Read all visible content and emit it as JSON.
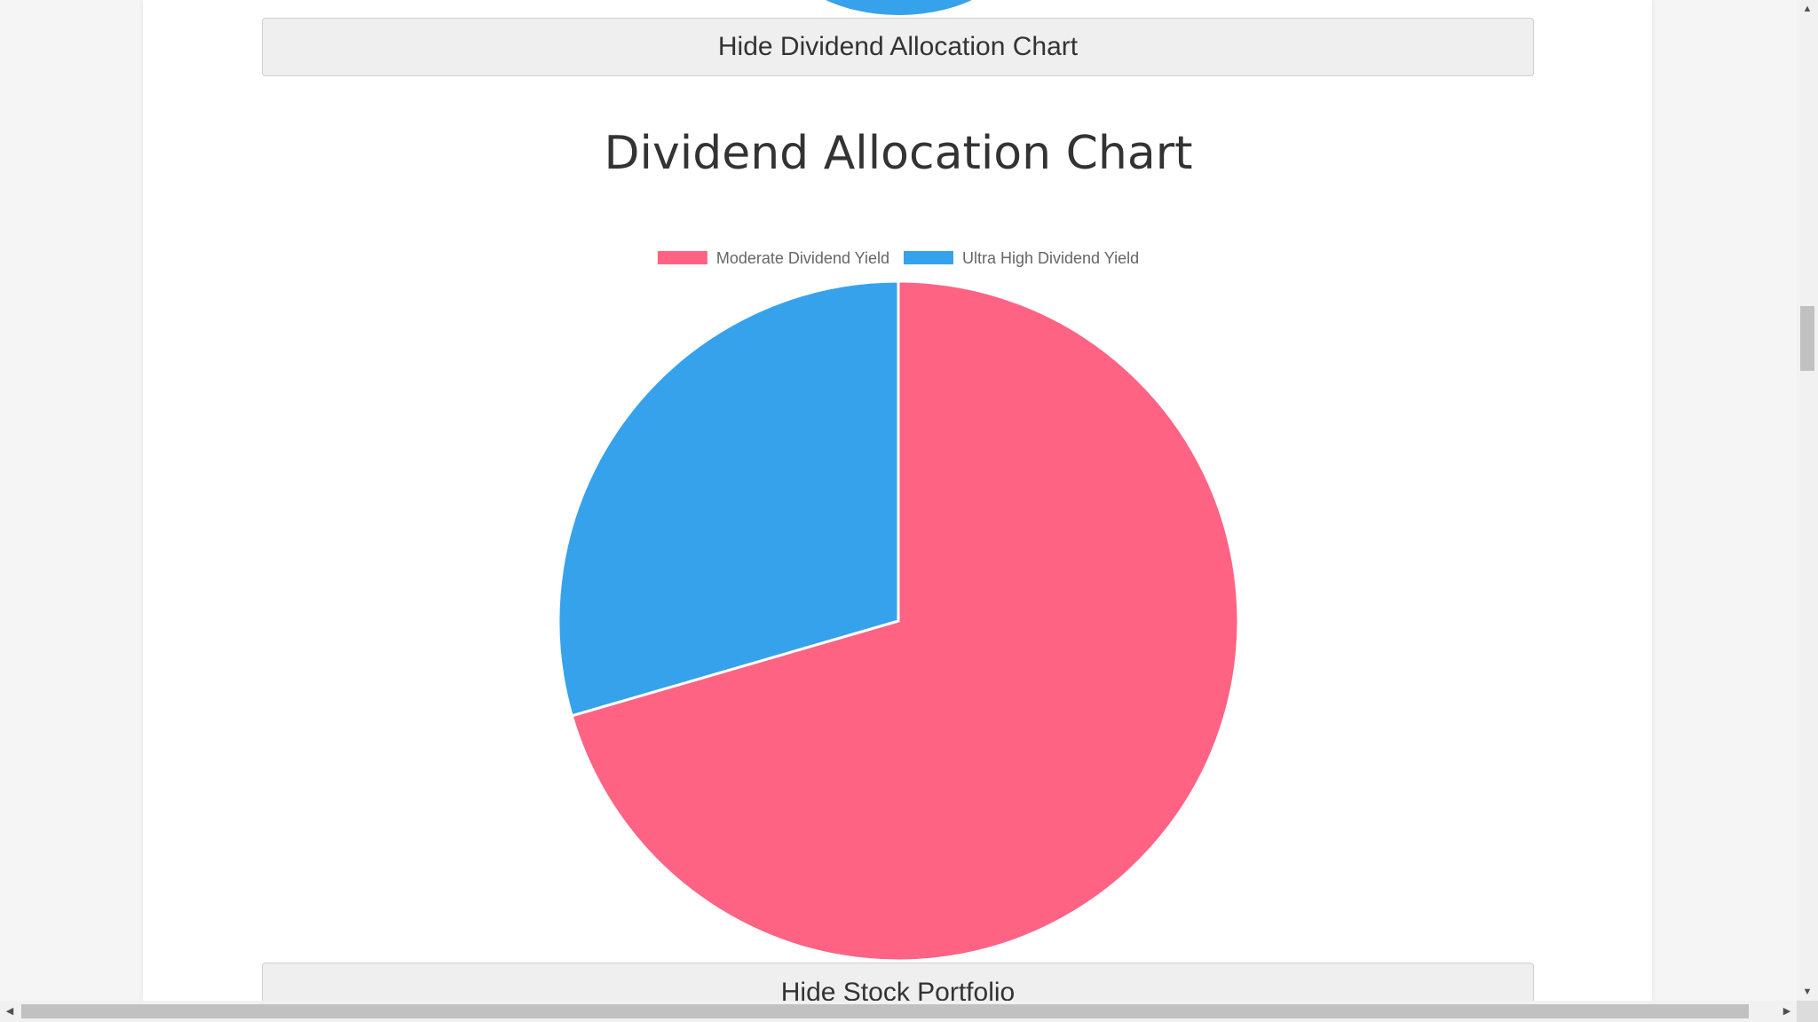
{
  "buttons": {
    "hide_dividend_chart": "Hide Dividend Allocation Chart",
    "hide_stock_portfolio": "Hide Stock Portfolio"
  },
  "chart_data": {
    "type": "pie",
    "title": "Dividend Allocation Chart",
    "categories": [
      "Moderate Dividend Yield",
      "Ultra High Dividend Yield"
    ],
    "values": [
      70.5,
      29.5
    ],
    "colors": [
      "#ff6384",
      "#36a2eb"
    ],
    "legend_position": "top"
  },
  "scrollbars": {
    "up_icon": "triangle-up",
    "down_icon": "triangle-down",
    "left_icon": "triangle-left",
    "right_icon": "triangle-right"
  }
}
